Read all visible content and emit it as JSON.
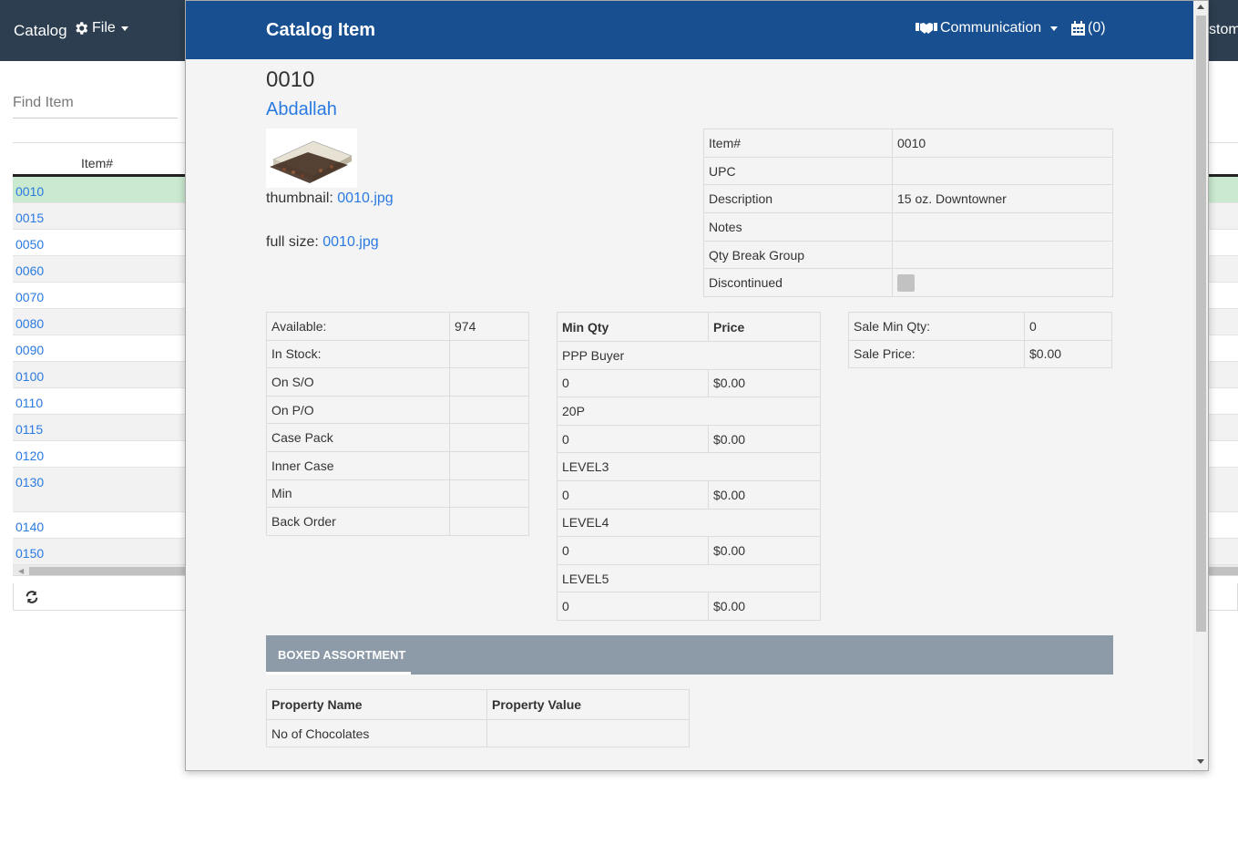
{
  "background": {
    "brand": "Catalog",
    "file_menu": "File",
    "right_clipped_text": "stome",
    "find_placeholder": "Find Item",
    "table_header": "Item#",
    "rows": [
      "0010",
      "0015",
      "0050",
      "0060",
      "0070",
      "0080",
      "0090",
      "0100",
      "0110",
      "0115",
      "0120",
      "0130",
      "0140",
      "0150"
    ],
    "selected_row": "0010",
    "colors": {
      "nav": "#2c3e50",
      "selected_row": "#c9e9d0",
      "link": "#2a7ae2"
    }
  },
  "modal": {
    "title": "Catalog Item",
    "communication_label": "Communication",
    "cart_count": "(0)",
    "item_number": "0010",
    "item_name": "Abdallah",
    "thumbnail_label": "thumbnail:",
    "thumbnail_file": "0010.jpg",
    "fullsize_label": "full size:",
    "fullsize_file": "0010.jpg",
    "info": [
      {
        "key": "Item#",
        "value": "0010"
      },
      {
        "key": "UPC",
        "value": ""
      },
      {
        "key": "Description",
        "value": "15 oz. Downtowner"
      },
      {
        "key": "Notes",
        "value": ""
      },
      {
        "key": "Qty Break Group",
        "value": ""
      },
      {
        "key": "Discontinued",
        "value": ""
      }
    ],
    "discontinued_checked": false,
    "stock": [
      {
        "key": "Available:",
        "value": "974"
      },
      {
        "key": "In Stock:",
        "value": ""
      },
      {
        "key": "On S/O",
        "value": ""
      },
      {
        "key": "On P/O",
        "value": ""
      },
      {
        "key": "Case Pack",
        "value": ""
      },
      {
        "key": "Inner Case",
        "value": ""
      },
      {
        "key": "Min",
        "value": ""
      },
      {
        "key": "Back Order",
        "value": ""
      }
    ],
    "price_table": {
      "headers": [
        "Min Qty",
        "Price"
      ],
      "groups": [
        {
          "name": "PPP Buyer",
          "min_qty": "0",
          "price": "$0.00"
        },
        {
          "name": "20P",
          "min_qty": "0",
          "price": "$0.00"
        },
        {
          "name": "LEVEL3",
          "min_qty": "0",
          "price": "$0.00"
        },
        {
          "name": "LEVEL4",
          "min_qty": "0",
          "price": "$0.00"
        },
        {
          "name": "LEVEL5",
          "min_qty": "0",
          "price": "$0.00"
        }
      ]
    },
    "sale": [
      {
        "key": "Sale Min Qty:",
        "value": "0"
      },
      {
        "key": "Sale Price:",
        "value": "$0.00"
      }
    ],
    "tab_label": "BOXED ASSORTMENT",
    "properties": {
      "headers": [
        "Property Name",
        "Property Value"
      ],
      "rows": [
        {
          "name": "No of Chocolates",
          "value": ""
        }
      ]
    },
    "colors": {
      "header": "#184f91",
      "tabbar": "#8d9aa8",
      "body": "#f4f4f4"
    }
  }
}
